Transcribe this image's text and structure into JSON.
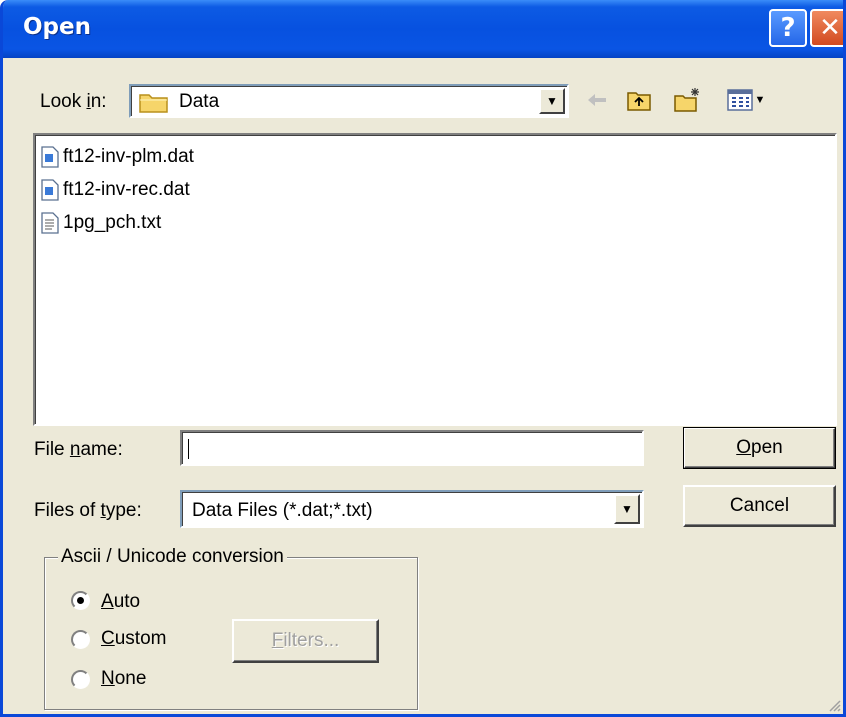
{
  "window": {
    "title": "Open"
  },
  "lookin": {
    "label": "Look ",
    "hotkey": "i",
    "label_rest": "n:",
    "value": "Data"
  },
  "files": [
    {
      "name": "ft12-inv-plm.dat",
      "icon": "dat-file-icon"
    },
    {
      "name": "ft12-inv-rec.dat",
      "icon": "dat-file-icon"
    },
    {
      "name": "1pg_pch.txt",
      "icon": "txt-file-icon"
    }
  ],
  "filename": {
    "label_pre": "File ",
    "hotkey": "n",
    "label_rest": "ame:",
    "value": ""
  },
  "filetype": {
    "label_pre": "Files of ",
    "hotkey": "t",
    "label_rest": "ype:",
    "value": "Data Files (*.dat;*.txt)"
  },
  "buttons": {
    "open_hotkey": "O",
    "open_rest": "pen",
    "cancel": "Cancel",
    "filters_hotkey": "F",
    "filters_rest": "ilters..."
  },
  "conversion": {
    "legend": "Ascii / Unicode conversion",
    "options": [
      {
        "hotkey": "A",
        "rest": "uto",
        "selected": true
      },
      {
        "hotkey": "C",
        "rest": "ustom",
        "selected": false
      },
      {
        "hotkey": "N",
        "rest": "one",
        "selected": false
      }
    ]
  },
  "colors": {
    "titlebar": "#0751e0",
    "dialog_bg": "#ece9d8",
    "close_button": "#d24a20"
  }
}
